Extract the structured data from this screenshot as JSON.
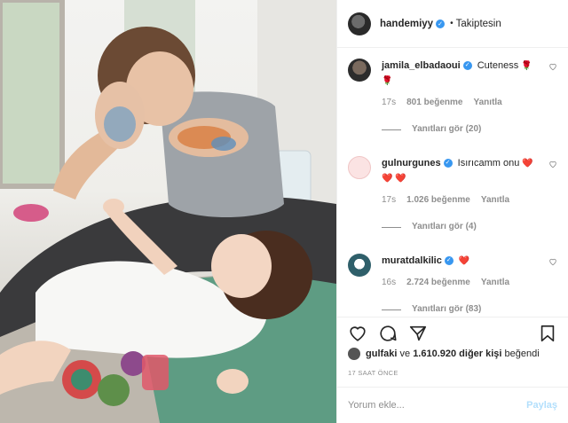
{
  "post": {
    "author": "handemiyy",
    "follow_state": "Takiptesin",
    "separator": "•",
    "more": "•••"
  },
  "comments": [
    {
      "user": "jamila_elbadaoui",
      "text": "Cuteness",
      "emoji": "🌹 🌹",
      "time": "17s",
      "likes": "801 beğenme",
      "reply": "Yanıtla",
      "replies": "Yanıtları gör (20)",
      "avatar_color": "#3a3a3a"
    },
    {
      "user": "gulnurgunes",
      "text": "Isırıcamm onu",
      "emoji": "❤️ ❤️ ❤️",
      "time": "17s",
      "likes": "1.026 beğenme",
      "reply": "Yanıtla",
      "replies": "Yanıtları gör (4)",
      "avatar_color": "#f7d6d6"
    },
    {
      "user": "muratdalkilic",
      "text": "",
      "emoji": "❤️",
      "time": "16s",
      "likes": "2.724 beğenme",
      "reply": "Yanıtla",
      "replies": "Yanıtları gör (83)",
      "avatar_color": "#2f5f6a"
    }
  ],
  "actions": {
    "like_icon": "heart-icon",
    "comment_icon": "comment-icon",
    "share_icon": "share-icon",
    "save_icon": "bookmark-icon"
  },
  "likes": {
    "user": "gulfaki",
    "connector": " ve ",
    "others": "1.610.920 diğer kişi",
    "suffix": " beğendi"
  },
  "timestamp": "17 SAAT ÖNCE",
  "add_comment": {
    "placeholder": "Yorum ekle...",
    "post_label": "Paylaş"
  },
  "colors": {
    "verified": "#3897f0",
    "muted": "#8e8e8e",
    "post_disabled": "#b2dffc"
  }
}
